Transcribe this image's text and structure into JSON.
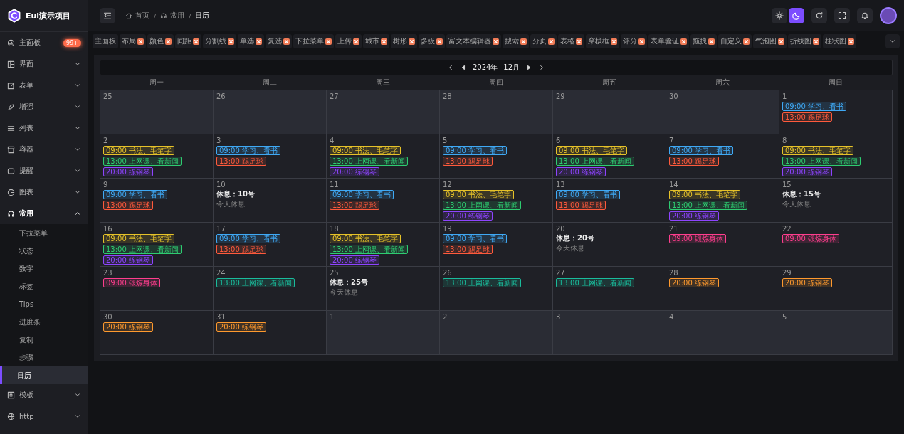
{
  "sidebar": {
    "logo": "Eui演示项目",
    "items": [
      {
        "label": "主面板",
        "badge": "99+"
      },
      {
        "label": "界面",
        "expanded": false
      },
      {
        "label": "表单",
        "expanded": false
      },
      {
        "label": "增强",
        "expanded": false
      },
      {
        "label": "列表",
        "expanded": false
      },
      {
        "label": "容器",
        "expanded": false
      },
      {
        "label": "提醒",
        "expanded": false
      },
      {
        "label": "图表",
        "expanded": false
      },
      {
        "label": "常用",
        "expanded": true,
        "children": [
          {
            "label": "下拉菜单",
            "selected": false
          },
          {
            "label": "状态",
            "selected": false
          },
          {
            "label": "数字",
            "selected": false
          },
          {
            "label": "标签",
            "selected": false
          },
          {
            "label": "Tips",
            "selected": false
          },
          {
            "label": "进度条",
            "selected": false
          },
          {
            "label": "复制",
            "selected": false
          },
          {
            "label": "步骤",
            "selected": false
          },
          {
            "label": "日历",
            "selected": true
          }
        ]
      },
      {
        "label": "模板",
        "expanded": false
      },
      {
        "label": "http",
        "expanded": false
      }
    ]
  },
  "header": {
    "separator": "/",
    "breadcrumb": [
      {
        "label": "首页"
      },
      {
        "label": "常用"
      },
      {
        "label": "日历"
      }
    ],
    "theme": [
      {
        "kind": "light",
        "selected": false
      },
      {
        "kind": "dark",
        "selected": true
      }
    ]
  },
  "tags": [
    {
      "label": "主面板",
      "closable": false
    },
    {
      "label": "布局",
      "closable": true
    },
    {
      "label": "颜色",
      "closable": true
    },
    {
      "label": "间距",
      "closable": true
    },
    {
      "label": "分割线",
      "closable": true
    },
    {
      "label": "单选",
      "closable": true
    },
    {
      "label": "复选",
      "closable": true
    },
    {
      "label": "下拉菜单",
      "closable": true
    },
    {
      "label": "上传",
      "closable": true
    },
    {
      "label": "城市",
      "closable": true
    },
    {
      "label": "树形",
      "closable": true
    },
    {
      "label": "多级",
      "closable": true
    },
    {
      "label": "富文本编辑器",
      "closable": true
    },
    {
      "label": "搜索",
      "closable": true
    },
    {
      "label": "分页",
      "closable": true
    },
    {
      "label": "表格",
      "closable": true
    },
    {
      "label": "穿梭框",
      "closable": true
    },
    {
      "label": "评分",
      "closable": true
    },
    {
      "label": "表单验证",
      "closable": true
    },
    {
      "label": "拖拽",
      "closable": true
    },
    {
      "label": "自定义",
      "closable": true
    },
    {
      "label": "气泡图",
      "closable": true
    },
    {
      "label": "折线图",
      "closable": true
    },
    {
      "label": "柱状图",
      "closable": true
    }
  ],
  "calendar": {
    "year": "2024年",
    "month": "12月",
    "weekdays": [
      "周一",
      "周二",
      "周三",
      "周四",
      "周五",
      "周六",
      "周日"
    ],
    "weeks": [
      [
        {
          "day": "25",
          "other_month": true
        },
        {
          "day": "26",
          "other_month": true
        },
        {
          "day": "27",
          "other_month": true
        },
        {
          "day": "28",
          "other_month": true
        },
        {
          "day": "29",
          "other_month": true
        },
        {
          "day": "30",
          "other_month": true
        },
        {
          "day": "1",
          "other_month": false,
          "events": [
            {
              "text": "09:00 学习、看书",
              "color": "#3fa9f5"
            },
            {
              "text": "13:00 踢足球",
              "color": "#ff5a3c"
            }
          ]
        }
      ],
      [
        {
          "day": "2",
          "other_month": false,
          "events": [
            {
              "text": "09:00 书法、毛笔字",
              "color": "#e6c229"
            },
            {
              "text": "13:00 上网课、看新闻",
              "color": "#2ecc71"
            },
            {
              "text": "20:00 练钢琴",
              "color": "#8e44ff"
            }
          ]
        },
        {
          "day": "3",
          "other_month": false,
          "events": [
            {
              "text": "09:00 学习、看书",
              "color": "#3fa9f5"
            },
            {
              "text": "13:00 踢足球",
              "color": "#ff5a3c"
            }
          ]
        },
        {
          "day": "4",
          "other_month": false,
          "events": [
            {
              "text": "09:00 书法、毛笔字",
              "color": "#e6c229"
            },
            {
              "text": "13:00 上网课、看新闻",
              "color": "#2ecc71"
            },
            {
              "text": "20:00 练钢琴",
              "color": "#8e44ff"
            }
          ]
        },
        {
          "day": "5",
          "other_month": false,
          "events": [
            {
              "text": "09:00 学习、看书",
              "color": "#3fa9f5"
            },
            {
              "text": "13:00 踢足球",
              "color": "#ff5a3c"
            }
          ]
        },
        {
          "day": "6",
          "other_month": false,
          "events": [
            {
              "text": "09:00 书法、毛笔字",
              "color": "#e6c229"
            },
            {
              "text": "13:00 上网课、看新闻",
              "color": "#2ecc71"
            },
            {
              "text": "20:00 练钢琴",
              "color": "#8e44ff"
            }
          ]
        },
        {
          "day": "7",
          "other_month": false,
          "events": [
            {
              "text": "09:00 学习、看书",
              "color": "#3fa9f5"
            },
            {
              "text": "13:00 踢足球",
              "color": "#ff5a3c"
            }
          ]
        },
        {
          "day": "8",
          "other_month": false,
          "events": [
            {
              "text": "09:00 书法、毛笔字",
              "color": "#e6c229"
            },
            {
              "text": "13:00 上网课、看新闻",
              "color": "#2ecc71"
            },
            {
              "text": "20:00 练钢琴",
              "color": "#8e44ff"
            }
          ]
        }
      ],
      [
        {
          "day": "9",
          "other_month": false,
          "events": [
            {
              "text": "09:00 学习、看书",
              "color": "#3fa9f5"
            },
            {
              "text": "13:00 踢足球",
              "color": "#ff5a3c"
            }
          ]
        },
        {
          "day": "10",
          "other_month": false,
          "rest_title": "休息：10号",
          "rest_note": "今天休息"
        },
        {
          "day": "11",
          "other_month": false,
          "events": [
            {
              "text": "09:00 学习、看书",
              "color": "#3fa9f5"
            },
            {
              "text": "13:00 踢足球",
              "color": "#ff5a3c"
            }
          ]
        },
        {
          "day": "12",
          "other_month": false,
          "events": [
            {
              "text": "09:00 书法、毛笔字",
              "color": "#e6c229"
            },
            {
              "text": "13:00 上网课、看新闻",
              "color": "#2ecc71"
            },
            {
              "text": "20:00 练钢琴",
              "color": "#8e44ff"
            }
          ]
        },
        {
          "day": "13",
          "other_month": false,
          "events": [
            {
              "text": "09:00 学习、看书",
              "color": "#3fa9f5"
            },
            {
              "text": "13:00 踢足球",
              "color": "#ff5a3c"
            }
          ]
        },
        {
          "day": "14",
          "other_month": false,
          "events": [
            {
              "text": "09:00 书法、毛笔字",
              "color": "#e6c229"
            },
            {
              "text": "13:00 上网课、看新闻",
              "color": "#2ecc71"
            },
            {
              "text": "20:00 练钢琴",
              "color": "#8e44ff"
            }
          ]
        },
        {
          "day": "15",
          "other_month": false,
          "rest_title": "休息：15号",
          "rest_note": "今天休息"
        }
      ],
      [
        {
          "day": "16",
          "other_month": false,
          "events": [
            {
              "text": "09:00 书法、毛笔字",
              "color": "#e6c229"
            },
            {
              "text": "13:00 上网课、看新闻",
              "color": "#2ecc71"
            },
            {
              "text": "20:00 练钢琴",
              "color": "#8e44ff"
            }
          ]
        },
        {
          "day": "17",
          "other_month": false,
          "events": [
            {
              "text": "09:00 学习、看书",
              "color": "#3fa9f5"
            },
            {
              "text": "13:00 踢足球",
              "color": "#ff5a3c"
            }
          ]
        },
        {
          "day": "18",
          "other_month": false,
          "events": [
            {
              "text": "09:00 书法、毛笔字",
              "color": "#e6c229"
            },
            {
              "text": "13:00 上网课、看新闻",
              "color": "#2ecc71"
            },
            {
              "text": "20:00 练钢琴",
              "color": "#8e44ff"
            }
          ]
        },
        {
          "day": "19",
          "other_month": false,
          "events": [
            {
              "text": "09:00 学习、看书",
              "color": "#3fa9f5"
            },
            {
              "text": "13:00 踢足球",
              "color": "#ff5a3c"
            }
          ]
        },
        {
          "day": "20",
          "other_month": false,
          "rest_title": "休息：20号",
          "rest_note": "今天休息"
        },
        {
          "day": "21",
          "other_month": false,
          "events": [
            {
              "text": "09:00 锻炼身体",
              "color": "#ff3e8e"
            }
          ]
        },
        {
          "day": "22",
          "other_month": false,
          "events": [
            {
              "text": "09:00 锻炼身体",
              "color": "#ff3e8e"
            }
          ]
        }
      ],
      [
        {
          "day": "23",
          "other_month": false,
          "events": [
            {
              "text": "09:00 锻炼身体",
              "color": "#ff3e8e"
            }
          ]
        },
        {
          "day": "24",
          "other_month": false,
          "events": [
            {
              "text": "13:00 上网课、看新闻",
              "color": "#1abc9c"
            }
          ]
        },
        {
          "day": "25",
          "other_month": false,
          "rest_title": "休息：25号",
          "rest_note": "今天休息"
        },
        {
          "day": "26",
          "other_month": false,
          "events": [
            {
              "text": "13:00 上网课、看新闻",
              "color": "#1abc9c"
            }
          ]
        },
        {
          "day": "27",
          "other_month": false,
          "events": [
            {
              "text": "13:00 上网课、看新闻",
              "color": "#1abc9c"
            }
          ]
        },
        {
          "day": "28",
          "other_month": false,
          "events": [
            {
              "text": "20:00 练钢琴",
              "color": "#ff9a2e"
            }
          ]
        },
        {
          "day": "29",
          "other_month": false,
          "events": [
            {
              "text": "20:00 练钢琴",
              "color": "#ff9a2e"
            }
          ]
        }
      ],
      [
        {
          "day": "30",
          "other_month": false,
          "events": [
            {
              "text": "20:00 练钢琴",
              "color": "#ff9a2e"
            }
          ]
        },
        {
          "day": "31",
          "other_month": false,
          "events": [
            {
              "text": "20:00 练钢琴",
              "color": "#ff9a2e"
            }
          ]
        },
        {
          "day": "1",
          "other_month": true
        },
        {
          "day": "2",
          "other_month": true
        },
        {
          "day": "3",
          "other_month": true
        },
        {
          "day": "4",
          "other_month": true
        },
        {
          "day": "5",
          "other_month": true
        }
      ]
    ]
  }
}
